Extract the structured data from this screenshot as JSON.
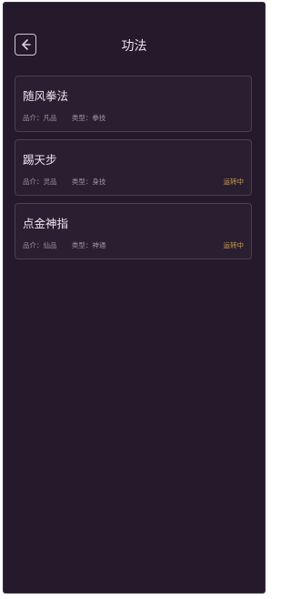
{
  "header": {
    "title": "功法",
    "back_icon": "arrow-left-icon"
  },
  "colors": {
    "panel_bg": "#251a2b",
    "card_border": "#4a4050",
    "status_color": "#d39b42"
  },
  "skills": [
    {
      "name": "随风拳法",
      "grade": "品介：凡品",
      "type": "类型：拳技",
      "status": ""
    },
    {
      "name": "踢天步",
      "grade": "品介：灵品",
      "type": "类型：身技",
      "status": "运转中"
    },
    {
      "name": "点金神指",
      "grade": "品介：仙品",
      "type": "类型：神通",
      "status": "运转中"
    }
  ]
}
